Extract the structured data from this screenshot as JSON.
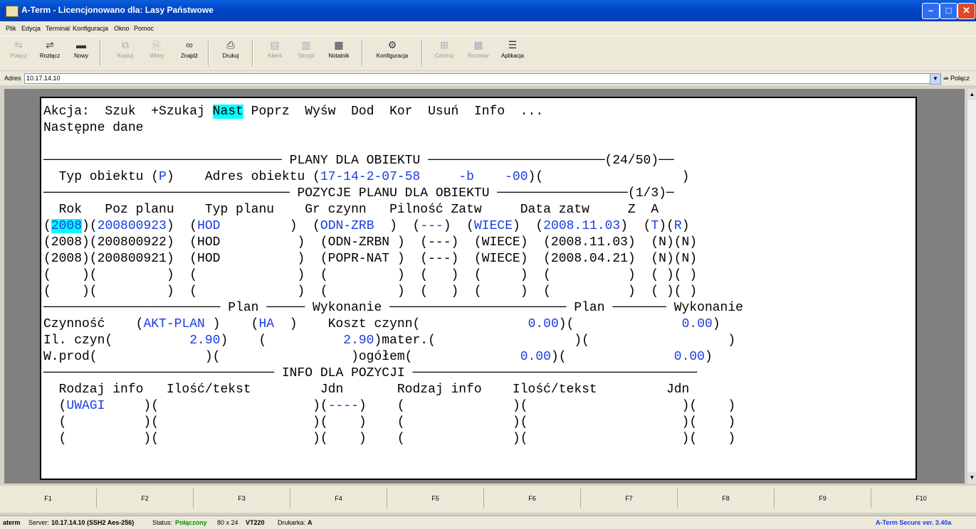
{
  "window": {
    "title": "A-Term - Licencjonowano dla: Lasy Państwowe"
  },
  "menu": [
    "Plik",
    "Edycja",
    "Terminal",
    "Konfiguracja",
    "Okno",
    "Pomoc"
  ],
  "toolbar": [
    {
      "label": "Połącz",
      "icon": "connect-icon",
      "enabled": false
    },
    {
      "label": "Rozłącz",
      "icon": "disconnect-icon",
      "enabled": true
    },
    {
      "label": "Nowy",
      "icon": "new-window-icon",
      "enabled": true
    },
    {
      "label": "Kopiuj",
      "icon": "copy-icon",
      "enabled": false
    },
    {
      "label": "Wklej",
      "icon": "paste-icon",
      "enabled": false
    },
    {
      "label": "Znajdź",
      "icon": "binoculars-icon",
      "enabled": true
    },
    {
      "label": "Drukuj",
      "icon": "printer-icon",
      "enabled": true
    },
    {
      "label": "Klient",
      "icon": "client-icon",
      "enabled": false
    },
    {
      "label": "Skrypt",
      "icon": "script-icon",
      "enabled": false
    },
    {
      "label": "Notatnik",
      "icon": "notepad-icon",
      "enabled": true
    },
    {
      "label": "Konfiguracja",
      "icon": "settings-icon",
      "enabled": true
    },
    {
      "label": "Centruj",
      "icon": "center-icon",
      "enabled": false
    },
    {
      "label": "Rozmiar",
      "icon": "resize-icon",
      "enabled": false
    },
    {
      "label": "Aplikacja",
      "icon": "app-icon",
      "enabled": true
    }
  ],
  "address": {
    "label": "Adres",
    "value": "10.17.14.10",
    "connect_label": "Połącz"
  },
  "terminal": {
    "l01": "Akcja:  Szuk  +Szukaj ",
    "l01_hl": "Nast",
    "l01_rest": " Poprz  Wyśw  Dod  Kor  Usuń  Info  ...",
    "l02": "Następne dane",
    "l04_a": "─────────────────────────────── PLANY DLA OBIEKTU ───────────────────────(24/50)──",
    "l05_a": "  Typ obiektu (",
    "l05_b": "P",
    "l05_c": ")    Adres obiektu (",
    "l05_d": "17-14-2-07-58     -b    -00",
    "l05_e": ")(                  )",
    "l06_a": "──────────────────────────────── POZYCJE PLANU DLA OBIEKTU ─────────────────(1/3)─",
    "l07_a": "  Rok   Poz planu    Typ planu    Gr czynn   Pilność Zatw     Data zatw     Z  A",
    "r1_a": "(",
    "r1_year": "2008",
    "r1_b": ")(",
    "r1_poz": "200800923",
    "r1_c": ")  (",
    "r1_typ": "HOD",
    "r1_d": "         )  (",
    "r1_gr": "ODN-ZRB",
    "r1_e": "  )  (",
    "r1_pil": "---",
    "r1_f": ")  (",
    "r1_zatw": "WIECE",
    "r1_g": ")  (",
    "r1_data": "2008.11.03",
    "r1_h": ")  (",
    "r1_z": "T",
    "r1_i": ")(",
    "r1_aa": "R",
    "r1_j": ")",
    "r2": "(2008)(200800922)  (HOD          )  (ODN-ZRBN )  (---)  (WIECE)  (2008.11.03)  (N)(N)",
    "r3": "(2008)(200800921)  (HOD          )  (POPR-NAT )  (---)  (WIECE)  (2008.04.21)  (N)(N)",
    "r4": "(    )(         )  (             )  (         )  (   )  (     )  (          )  ( )( )",
    "r5": "(    )(         )  (             )  (         )  (   )  (     )  (          )  ( )( )",
    "l13": "─────────────────────── Plan ───── Wykonanie ─────────────────────── Plan ─────── Wykonanie",
    "l14_a": "Czynność    (",
    "l14_b": "AKT-PLAN",
    "l14_c": " )    (",
    "l14_d": "HA",
    "l14_e": "  )    Koszt czynn(              ",
    "l14_f": "0.00",
    "l14_g": ")(              ",
    "l14_h": "0.00",
    "l14_i": ")",
    "l15_a": "Il. czyn(          ",
    "l15_b": "2.90",
    "l15_c": ")    (          ",
    "l15_d": "2.90",
    "l15_e": ")mater.(                  )(                  )",
    "l16_a": "W.prod(              )(                 )ogółem(              ",
    "l16_b": "0.00",
    "l16_c": ")(              ",
    "l16_d": "0.00",
    "l16_e": ")",
    "l17": "────────────────────────────── INFO DLA POZYCJI ─────────────────────────────────────",
    "l18": "  Rodzaj info   Ilość/tekst         Jdn       Rodzaj info    Ilość/tekst         Jdn",
    "l19_a": "  (",
    "l19_b": "UWAGI",
    "l19_c": "     )(                    )(",
    "l19_d": "----",
    "l19_e": ")    (              )(                    )(    )",
    "l20": "  (          )(                    )(    )    (              )(                    )(    )",
    "l21": "  (          )(                    )(    )    (              )(                    )(    )"
  },
  "fkeys": [
    "F1",
    "F2",
    "F3",
    "F4",
    "F5",
    "F6",
    "F7",
    "F8",
    "F9",
    "F10"
  ],
  "status": {
    "app": "aterm",
    "server_label": "Server:",
    "server_value": "10.17.14.10 (SSH2 Aes-256)",
    "status_label": "Status:",
    "status_value": "Połączony",
    "size": "80 x 24",
    "emulation": "VT220",
    "printer_label": "Drukarka:",
    "printer_value": "A",
    "version": "A-Term Secure ver. 3.40a"
  }
}
